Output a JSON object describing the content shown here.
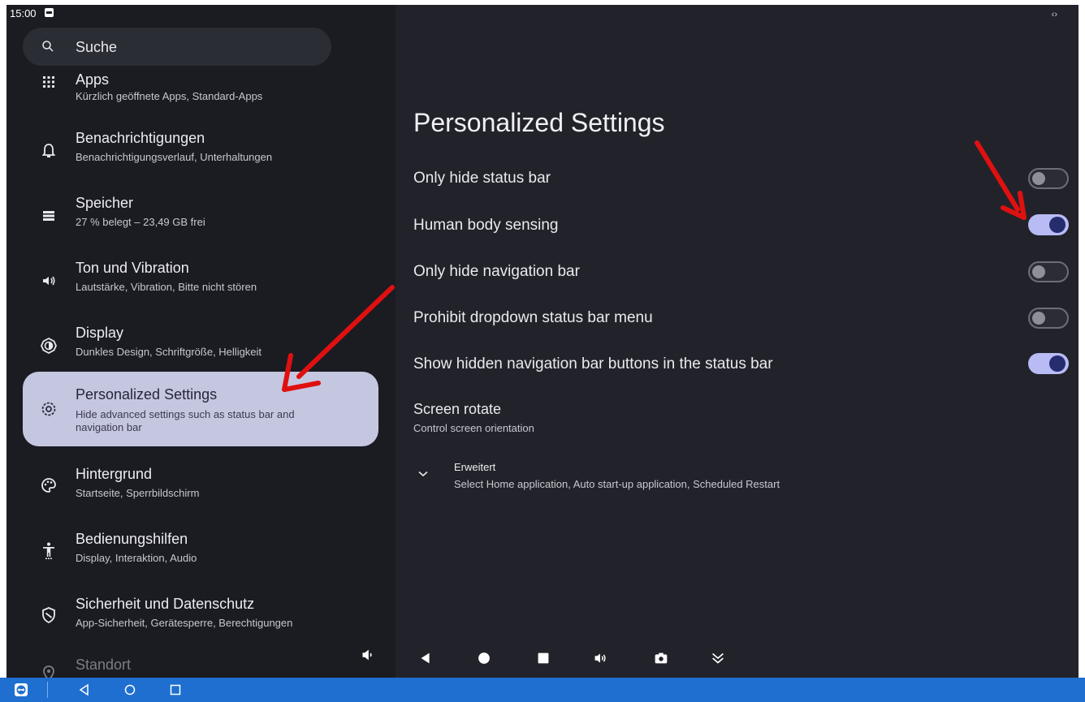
{
  "status": {
    "time": "15:00"
  },
  "search": {
    "placeholder": "Suche"
  },
  "sidebar": {
    "items": [
      {
        "title": "Apps",
        "subtitle": "Kürzlich geöffnete Apps, Standard-Apps",
        "icon": "apps-grid-icon"
      },
      {
        "title": "Benachrichtigungen",
        "subtitle": "Benachrichtigungsverlauf, Unterhaltungen",
        "icon": "bell-icon"
      },
      {
        "title": "Speicher",
        "subtitle": "27 % belegt – 23,49 GB frei",
        "icon": "storage-icon"
      },
      {
        "title": "Ton und Vibration",
        "subtitle": "Lautstärke, Vibration, Bitte nicht stören",
        "icon": "speaker-icon"
      },
      {
        "title": "Display",
        "subtitle": "Dunkles Design, Schriftgröße, Helligkeit",
        "icon": "brightness-icon"
      },
      {
        "title": "Personalized Settings",
        "subtitle": "Hide advanced settings such as status bar and",
        "subtitle2": "navigation bar",
        "icon": "gear-icon",
        "active": true
      },
      {
        "title": "Hintergrund",
        "subtitle": "Startseite, Sperrbildschirm",
        "icon": "palette-icon"
      },
      {
        "title": "Bedienungshilfen",
        "subtitle": "Display, Interaktion, Audio",
        "icon": "accessibility-icon"
      },
      {
        "title": "Sicherheit und Datenschutz",
        "subtitle": "App-Sicherheit, Gerätesperre, Berechtigungen",
        "icon": "shield-icon"
      },
      {
        "title": "Standort",
        "icon": "location-icon"
      }
    ]
  },
  "main": {
    "title": "Personalized Settings",
    "toggles": [
      {
        "label": "Only hide status bar",
        "on": false
      },
      {
        "label": "Human body sensing",
        "on": true
      },
      {
        "label": "Only hide navigation bar",
        "on": false
      },
      {
        "label": "Prohibit dropdown status bar menu",
        "on": false
      },
      {
        "label": "Show hidden navigation bar buttons in the status bar",
        "on": true
      }
    ],
    "screen_rotate": {
      "title": "Screen rotate",
      "subtitle": "Control screen orientation"
    },
    "advanced": {
      "title": "Erweitert",
      "subtitle": "Select Home application, Auto start-up application, Scheduled Restart"
    }
  },
  "navbar": {
    "buttons": [
      "volume-down-icon",
      "back-icon",
      "home-icon",
      "recents-icon",
      "volume-up-icon",
      "screenshot-icon",
      "collapse-icon"
    ]
  },
  "taskbar": {
    "buttons": [
      "teamviewer-icon",
      "back-icon",
      "home-icon",
      "recents-icon"
    ]
  },
  "colors": {
    "accent": "#b8bbf4",
    "active_item_bg": "#c5c7e1",
    "taskbar": "#1e6fd0",
    "annotation_arrow": "#e01010"
  }
}
